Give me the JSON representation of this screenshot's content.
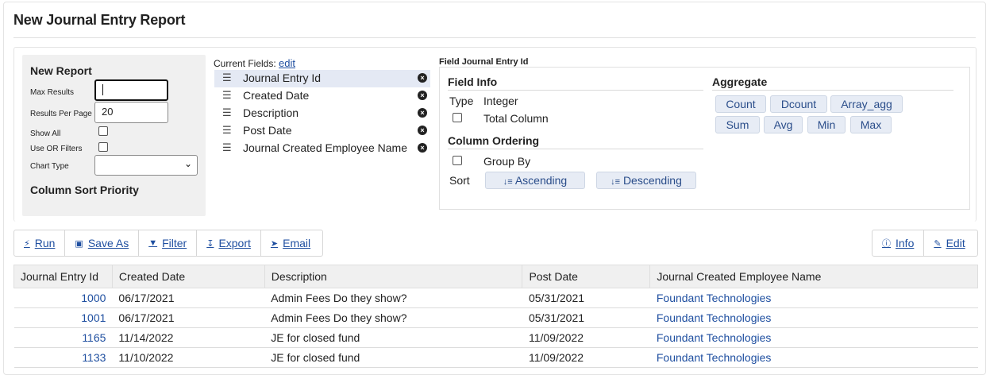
{
  "page_title": "New Journal Entry Report",
  "new_report": {
    "title": "New Report",
    "max_results_label": "Max Results",
    "max_results_value": "",
    "results_per_page_label": "Results Per Page",
    "results_per_page_value": "20",
    "show_all_label": "Show All",
    "use_or_filters_label": "Use OR Filters",
    "chart_type_label": "Chart Type",
    "chart_type_value": "",
    "column_sort_priority": "Column Sort Priority"
  },
  "current_fields": {
    "label": "Current Fields:",
    "edit_link": "edit",
    "items": [
      {
        "label": "Journal Entry Id",
        "selected": true
      },
      {
        "label": "Created Date",
        "selected": false
      },
      {
        "label": "Description",
        "selected": false
      },
      {
        "label": "Post Date",
        "selected": false
      },
      {
        "label": "Journal Created Employee Name",
        "selected": false
      }
    ]
  },
  "field_panel": {
    "title": "Field Journal Entry Id",
    "field_info": "Field Info",
    "type_label": "Type",
    "type_value": "Integer",
    "total_column_label": "Total Column",
    "column_ordering": "Column Ordering",
    "group_by_label": "Group By",
    "sort_label": "Sort",
    "ascending": "Ascending",
    "descending": "Descending",
    "aggregate": "Aggregate",
    "aggregates": [
      "Count",
      "Dcount",
      "Array_agg",
      "Sum",
      "Avg",
      "Min",
      "Max"
    ]
  },
  "toolbar": {
    "run": "Run",
    "save_as": "Save As",
    "filter": "Filter",
    "export": "Export",
    "email": "Email",
    "info": "Info",
    "edit": "Edit"
  },
  "table": {
    "columns": [
      "Journal Entry Id",
      "Created Date",
      "Description",
      "Post Date",
      "Journal Created Employee Name"
    ],
    "rows": [
      [
        "1000",
        "06/17/2021",
        "Admin Fees Do they show?",
        "05/31/2021",
        "Foundant Technologies"
      ],
      [
        "1001",
        "06/17/2021",
        "Admin Fees Do they show?",
        "05/31/2021",
        "Foundant Technologies"
      ],
      [
        "1165",
        "11/14/2022",
        "JE for closed fund",
        "11/09/2022",
        "Foundant Technologies"
      ],
      [
        "1133",
        "11/10/2022",
        "JE for closed fund",
        "11/09/2022",
        "Foundant Technologies"
      ]
    ]
  },
  "colors": {
    "link": "#1f4fa0",
    "pill_bg": "#e7ecf5",
    "header_bg": "#f0f0f0"
  }
}
